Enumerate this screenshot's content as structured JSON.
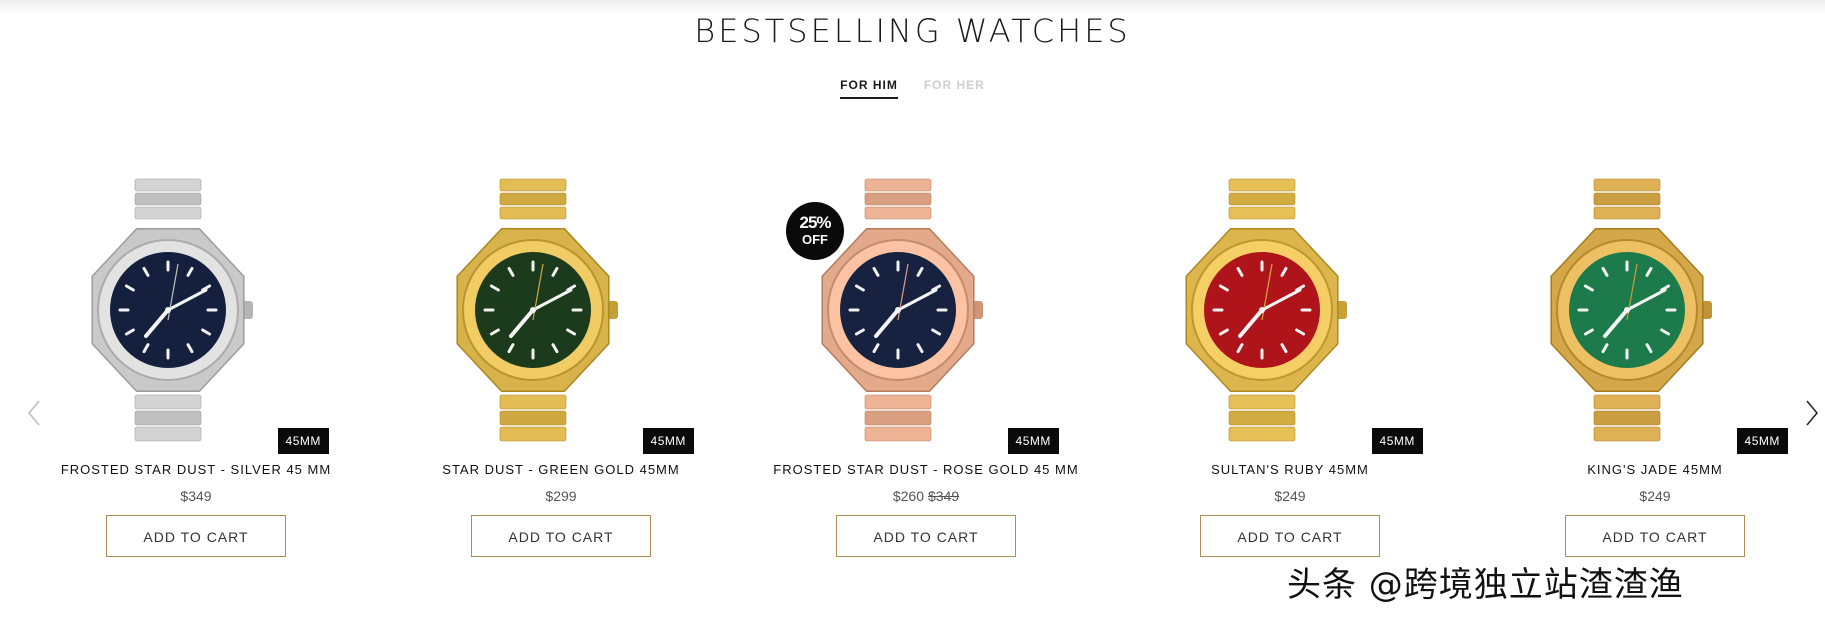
{
  "section": {
    "title": "BESTSELLING WATCHES",
    "tabs": [
      {
        "label": "FOR HIM",
        "active": true
      },
      {
        "label": "FOR HER",
        "active": false
      }
    ]
  },
  "carousel": {
    "prev_icon": "chevron-left-icon",
    "next_icon": "chevron-right-icon"
  },
  "products": [
    {
      "name": "FROSTED STAR DUST - SILVER 45 MM",
      "size": "45MM",
      "price": "$349",
      "old_price": "",
      "cart_label": "ADD TO CART",
      "case_color": "#c9c9c9",
      "dial_color": "#14203d"
    },
    {
      "name": "STAR DUST - GREEN GOLD 45MM",
      "size": "45MM",
      "price": "$299",
      "old_price": "",
      "cart_label": "ADD TO CART",
      "case_color": "#d8b24a",
      "dial_color": "#1c3a1c"
    },
    {
      "name": "FROSTED STAR DUST - ROSE GOLD 45 MM",
      "size": "45MM",
      "price": "$260",
      "old_price": "$349",
      "cart_label": "ADD TO CART",
      "case_color": "#e2a98b",
      "dial_color": "#16223f",
      "discount": {
        "pct": "25%",
        "off": "OFF"
      }
    },
    {
      "name": "SULTAN'S RUBY 45MM",
      "size": "45MM",
      "price": "$249",
      "old_price": "",
      "cart_label": "ADD TO CART",
      "case_color": "#dcb54d",
      "dial_color": "#b0141b"
    },
    {
      "name": "KING'S JADE 45MM",
      "size": "45MM",
      "price": "$249",
      "old_price": "",
      "cart_label": "ADD TO CART",
      "case_color": "#d4a84a",
      "dial_color": "#1d7a4b"
    }
  ],
  "watermark": "头条 @跨境独立站渣渣渔"
}
